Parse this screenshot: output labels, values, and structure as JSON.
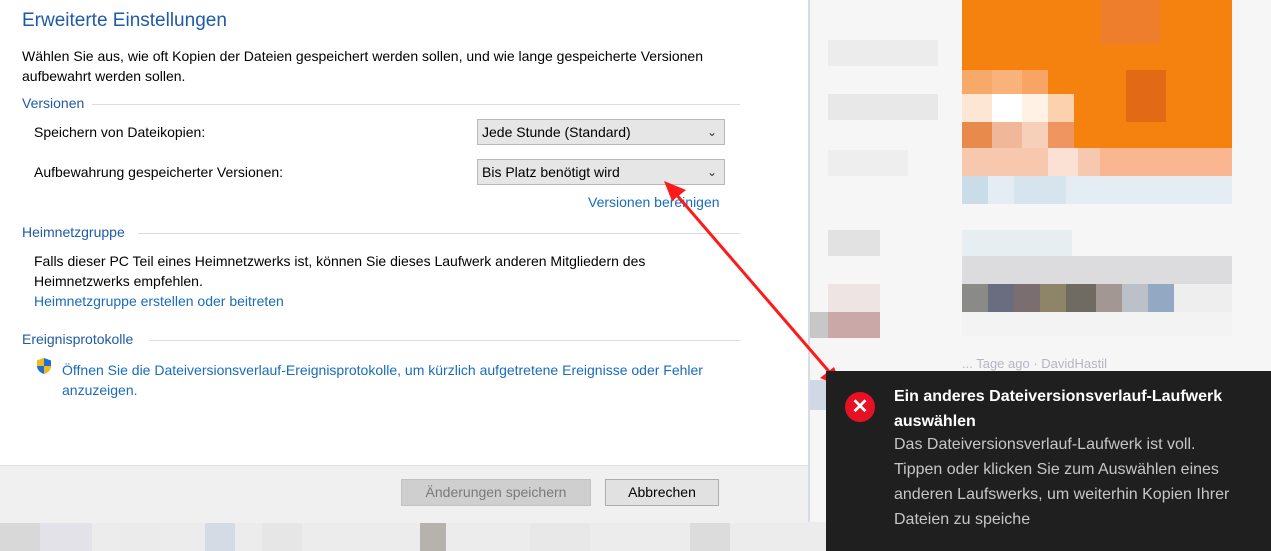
{
  "dialog": {
    "title": "Erweiterte Einstellungen",
    "description": "Wählen Sie aus, wie oft Kopien der Dateien gespeichert werden sollen, und wie lange gespeicherte Versionen aufbewahrt werden sollen.",
    "versions": {
      "heading": "Versionen",
      "save_copies_label": "Speichern von Dateikopien:",
      "save_copies_value": "Jede Stunde (Standard)",
      "retention_label": "Aufbewahrung gespeicherter Versionen:",
      "retention_value": "Bis Platz benötigt wird",
      "cleanup_link": "Versionen bereinigen"
    },
    "homegroup": {
      "heading": "Heimnetzgruppe",
      "text": "Falls dieser PC Teil eines Heimnetzwerks ist, können Sie dieses Laufwerk anderen Mitgliedern des Heimnetzwerks empfehlen.",
      "link": "Heimnetzgruppe erstellen oder beitreten"
    },
    "event_logs": {
      "heading": "Ereignisprotokolle",
      "link": "Öffnen Sie die Dateiversionsverlauf-Ereignisprotokolle, um kürzlich aufgetretene Ereignisse oder Fehler anzuzeigen."
    },
    "buttons": {
      "save": "Änderungen speichern",
      "cancel": "Abbrechen"
    }
  },
  "toast": {
    "title": "Ein anderes Dateiversionsverlauf-Laufwerk auswählen",
    "body": "Das Dateiversionsverlauf-Laufwerk ist voll. Tippen oder klicken Sie zum Auswählen eines anderen Laufswerks, um weiterhin Kopien Ihrer Dateien zu speiche",
    "icon": "error-icon",
    "icon_color": "#e81123"
  },
  "background": {
    "partial_text": "... Tage ago · DavidHastil"
  },
  "colors": {
    "heading_blue": "#1f5aa6",
    "link_blue": "#1a6bbd",
    "arrow_red": "#ff1a1a",
    "toast_bg": "#1f1f1f"
  }
}
